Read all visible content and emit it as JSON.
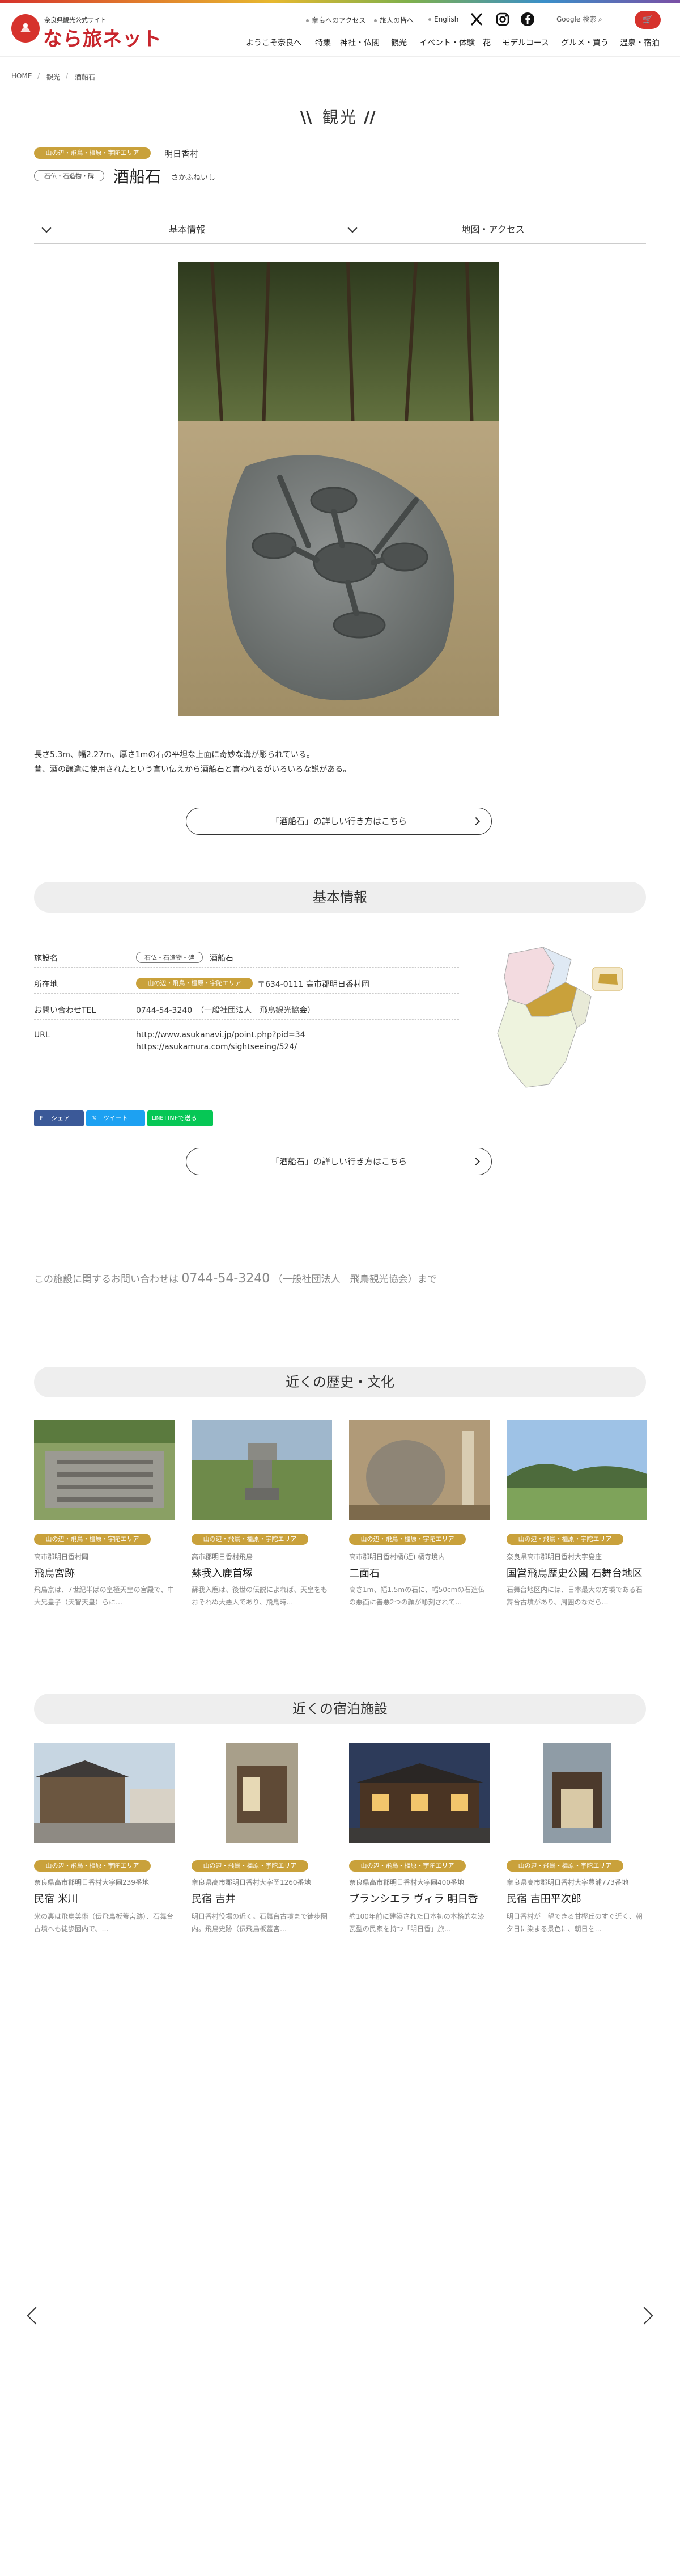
{
  "header": {
    "site_sub": "奈良県観光公式サイト",
    "site_name": "なら旅ネット",
    "util_links": [
      "奈良へのアクセス",
      "旅人の皆へ",
      "English"
    ],
    "google_label": "Google 検索",
    "cart_icon": "cart-icon",
    "nav": [
      "ようこそ奈良へ",
      "特集",
      "神社・仏閣",
      "観光",
      "イベント・体験",
      "花",
      "モデルコース",
      "グルメ・買う",
      "温泉・宿泊"
    ]
  },
  "breadcrumb": [
    "HOME",
    "観光",
    "酒船石"
  ],
  "page_heading": "観光",
  "spot": {
    "area_tag": "山の辺・飛鳥・橿原・宇陀エリア",
    "area": "明日香村",
    "category_tag": "石仏・石造物・碑",
    "name": "酒船石",
    "kana": "さかふねいし"
  },
  "tabs": [
    "基本情報",
    "地図・アクセス"
  ],
  "description": [
    "長さ5.3m、幅2.27m、厚さ1mの石の平坦な上面に奇妙な溝が彫られている。",
    "昔、酒の醸造に使用されたという言い伝えから酒船石と言われるがいろいろな説がある。"
  ],
  "route_button": "「酒船石」の詳しい行き方はこちら",
  "basic": {
    "section_title": "基本情報",
    "facility_label": "施設名",
    "facility_tag": "石仏・石造物・碑",
    "facility_name": "酒船石",
    "address_label": "所在地",
    "address_tag": "山の辺・飛鳥・橿原・宇陀エリア",
    "address": "〒634-0111 高市郡明日香村岡",
    "tel_label": "お問い合わせTEL",
    "tel": "0744-54-3240　（一般社団法人　飛鳥観光協会）",
    "url_label": "URL",
    "url1": "http://www.asukanavi.jp/point.php?pid=34",
    "url2": "https://asukamura.com/sightseeing/524/"
  },
  "share": {
    "facebook": "シェア",
    "twitter": "ツイート",
    "line": "LINEで送る"
  },
  "contact": {
    "prefix": "この施設に関するお問い合わせは",
    "tel": "0744-54-3240",
    "suffix": "（一般社団法人　飛鳥観光協会）まで"
  },
  "nearby_culture": {
    "title": "近くの歴史・文化",
    "cards": [
      {
        "tag": "山の辺・飛鳥・橿原・宇陀エリア",
        "loc": "高市郡明日香村岡",
        "title": "飛鳥宮跡",
        "text": "飛鳥京は、7世紀半ばの皇極天皇の宮殿で、中大兄皇子（天智天皇）らに…"
      },
      {
        "tag": "山の辺・飛鳥・橿原・宇陀エリア",
        "loc": "高市郡明日香村飛鳥",
        "title": "蘇我入鹿首塚",
        "text": "蘇我入鹿は、後世の伝説によれば、天皇をもおそれぬ大悪人であり、飛鳥時…"
      },
      {
        "tag": "山の辺・飛鳥・橿原・宇陀エリア",
        "loc": "高市郡明日香村橘(近) 橘寺境内",
        "title": "二面石",
        "text": "高さ1m、幅1.5mの石に、幅50cmの石造仏の悪面に善悪2つの顔が彫刻されて…"
      },
      {
        "tag": "山の辺・飛鳥・橿原・宇陀エリア",
        "loc": "奈良県高市郡明日香村大字島庄",
        "title": "国営飛鳥歴史公園 石舞台地区",
        "text": "石舞台地区内には、日本最大の方墳である石舞台古墳があり、周囲のなだら…"
      }
    ]
  },
  "nearby_stay": {
    "title": "近くの宿泊施設",
    "cards": [
      {
        "tag": "山の辺・飛鳥・橿原・宇陀エリア",
        "loc": "奈良県高市郡明日香村大字岡239番地",
        "title": "民宿 米川",
        "text": "米の裏は飛鳥美術（伝飛鳥板蓋宮跡）、石舞台古墳へも徒歩圏内で、…"
      },
      {
        "tag": "山の辺・飛鳥・橿原・宇陀エリア",
        "loc": "奈良県高市郡明日香村大字岡1260番地",
        "title": "民宿 吉井",
        "text": "明日香村役場の近く。石舞台古墳まで徒歩圏内。飛鳥史跡（伝飛鳥板蓋宮…"
      },
      {
        "tag": "山の辺・飛鳥・橿原・宇陀エリア",
        "loc": "奈良県高市郡明日香村大字岡400番地",
        "title": "ブランシエラ ヴィラ 明日香",
        "text": "約100年前に建築された日本初の本格的な漆瓦型の民家を持つ「明日香」旅…"
      },
      {
        "tag": "山の辺・飛鳥・橿原・宇陀エリア",
        "loc": "奈良県高市郡明日香村大字豊浦773番地",
        "title": "民宿 吉田平次郎",
        "text": "明日香村が一望できる甘樫丘のすぐ近く、朝夕日に染まる景色に、朝日を…"
      }
    ]
  }
}
